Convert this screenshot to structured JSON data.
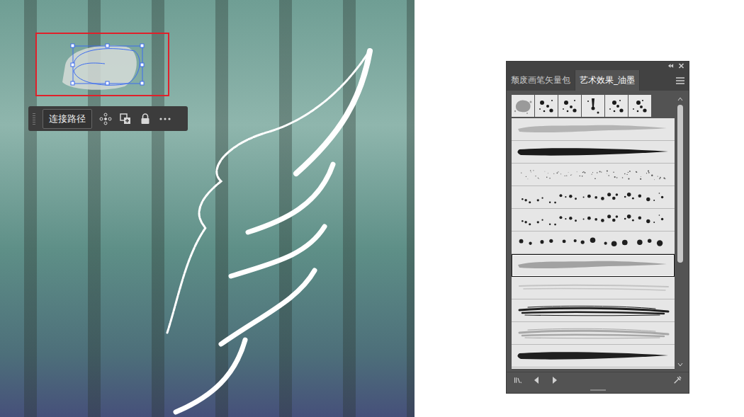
{
  "canvas": {
    "toolbar": {
      "button": "连接路径"
    },
    "path_selected": true
  },
  "brush_panel": {
    "tabs": [
      {
        "label": "颓废画笔矢量包",
        "selected": false
      },
      {
        "label": "艺术效果_油墨",
        "selected": true
      }
    ],
    "scatter_brushes": [
      {
        "kind": "splat",
        "color": "#9a9a9a",
        "selected": false
      },
      {
        "kind": "drops",
        "color": "#1a1a1a",
        "selected": false
      },
      {
        "kind": "drops",
        "color": "#1a1a1a",
        "selected": false
      },
      {
        "kind": "drip",
        "color": "#1a1a1a",
        "selected": false
      },
      {
        "kind": "drops",
        "color": "#1a1a1a",
        "selected": false
      },
      {
        "kind": "drops",
        "color": "#1a1a1a",
        "selected": false
      }
    ],
    "stroke_brushes": [
      {
        "kind": "smear",
        "color": "#b4b4b4",
        "selected": false
      },
      {
        "kind": "bold",
        "color": "#1a1a1a",
        "selected": false
      },
      {
        "kind": "speckle",
        "color": "#555555",
        "selected": false
      },
      {
        "kind": "spatter",
        "color": "#1f1f1f",
        "selected": false
      },
      {
        "kind": "spatter",
        "color": "#1f1f1f",
        "selected": false
      },
      {
        "kind": "blots",
        "color": "#1f1f1f",
        "selected": false
      },
      {
        "kind": "smear",
        "color": "#a2a2a2",
        "selected": true
      },
      {
        "kind": "streak",
        "color": "#c4c4c4",
        "selected": false
      },
      {
        "kind": "drybrush",
        "color": "#1f1f1f",
        "selected": false
      },
      {
        "kind": "drybrush",
        "color": "#a8a8a8",
        "selected": false
      },
      {
        "kind": "bold",
        "color": "#1f1f1f",
        "selected": false
      }
    ],
    "scrollbar": {
      "level": 0.62
    }
  }
}
